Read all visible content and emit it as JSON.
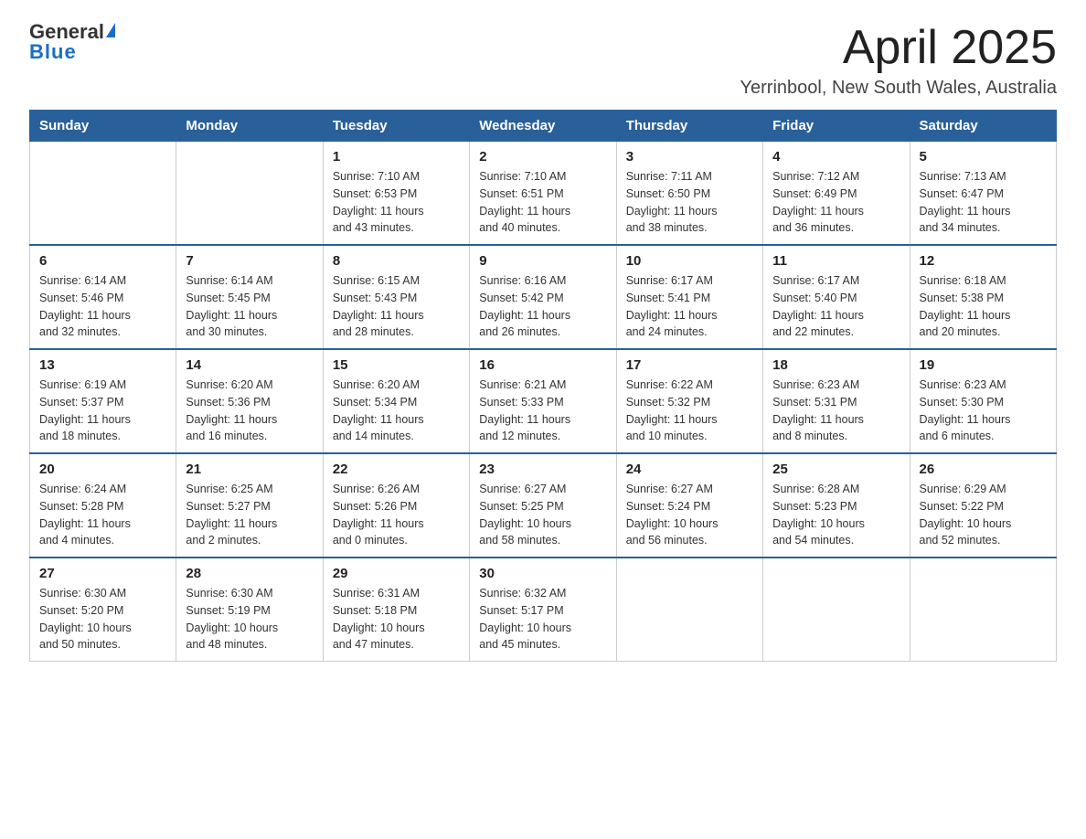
{
  "header": {
    "logo_general": "General",
    "logo_blue": "Blue",
    "month_title": "April 2025",
    "location": "Yerrinbool, New South Wales, Australia"
  },
  "columns": [
    "Sunday",
    "Monday",
    "Tuesday",
    "Wednesday",
    "Thursday",
    "Friday",
    "Saturday"
  ],
  "weeks": [
    [
      {
        "day": "",
        "info": ""
      },
      {
        "day": "",
        "info": ""
      },
      {
        "day": "1",
        "info": "Sunrise: 7:10 AM\nSunset: 6:53 PM\nDaylight: 11 hours\nand 43 minutes."
      },
      {
        "day": "2",
        "info": "Sunrise: 7:10 AM\nSunset: 6:51 PM\nDaylight: 11 hours\nand 40 minutes."
      },
      {
        "day": "3",
        "info": "Sunrise: 7:11 AM\nSunset: 6:50 PM\nDaylight: 11 hours\nand 38 minutes."
      },
      {
        "day": "4",
        "info": "Sunrise: 7:12 AM\nSunset: 6:49 PM\nDaylight: 11 hours\nand 36 minutes."
      },
      {
        "day": "5",
        "info": "Sunrise: 7:13 AM\nSunset: 6:47 PM\nDaylight: 11 hours\nand 34 minutes."
      }
    ],
    [
      {
        "day": "6",
        "info": "Sunrise: 6:14 AM\nSunset: 5:46 PM\nDaylight: 11 hours\nand 32 minutes."
      },
      {
        "day": "7",
        "info": "Sunrise: 6:14 AM\nSunset: 5:45 PM\nDaylight: 11 hours\nand 30 minutes."
      },
      {
        "day": "8",
        "info": "Sunrise: 6:15 AM\nSunset: 5:43 PM\nDaylight: 11 hours\nand 28 minutes."
      },
      {
        "day": "9",
        "info": "Sunrise: 6:16 AM\nSunset: 5:42 PM\nDaylight: 11 hours\nand 26 minutes."
      },
      {
        "day": "10",
        "info": "Sunrise: 6:17 AM\nSunset: 5:41 PM\nDaylight: 11 hours\nand 24 minutes."
      },
      {
        "day": "11",
        "info": "Sunrise: 6:17 AM\nSunset: 5:40 PM\nDaylight: 11 hours\nand 22 minutes."
      },
      {
        "day": "12",
        "info": "Sunrise: 6:18 AM\nSunset: 5:38 PM\nDaylight: 11 hours\nand 20 minutes."
      }
    ],
    [
      {
        "day": "13",
        "info": "Sunrise: 6:19 AM\nSunset: 5:37 PM\nDaylight: 11 hours\nand 18 minutes."
      },
      {
        "day": "14",
        "info": "Sunrise: 6:20 AM\nSunset: 5:36 PM\nDaylight: 11 hours\nand 16 minutes."
      },
      {
        "day": "15",
        "info": "Sunrise: 6:20 AM\nSunset: 5:34 PM\nDaylight: 11 hours\nand 14 minutes."
      },
      {
        "day": "16",
        "info": "Sunrise: 6:21 AM\nSunset: 5:33 PM\nDaylight: 11 hours\nand 12 minutes."
      },
      {
        "day": "17",
        "info": "Sunrise: 6:22 AM\nSunset: 5:32 PM\nDaylight: 11 hours\nand 10 minutes."
      },
      {
        "day": "18",
        "info": "Sunrise: 6:23 AM\nSunset: 5:31 PM\nDaylight: 11 hours\nand 8 minutes."
      },
      {
        "day": "19",
        "info": "Sunrise: 6:23 AM\nSunset: 5:30 PM\nDaylight: 11 hours\nand 6 minutes."
      }
    ],
    [
      {
        "day": "20",
        "info": "Sunrise: 6:24 AM\nSunset: 5:28 PM\nDaylight: 11 hours\nand 4 minutes."
      },
      {
        "day": "21",
        "info": "Sunrise: 6:25 AM\nSunset: 5:27 PM\nDaylight: 11 hours\nand 2 minutes."
      },
      {
        "day": "22",
        "info": "Sunrise: 6:26 AM\nSunset: 5:26 PM\nDaylight: 11 hours\nand 0 minutes."
      },
      {
        "day": "23",
        "info": "Sunrise: 6:27 AM\nSunset: 5:25 PM\nDaylight: 10 hours\nand 58 minutes."
      },
      {
        "day": "24",
        "info": "Sunrise: 6:27 AM\nSunset: 5:24 PM\nDaylight: 10 hours\nand 56 minutes."
      },
      {
        "day": "25",
        "info": "Sunrise: 6:28 AM\nSunset: 5:23 PM\nDaylight: 10 hours\nand 54 minutes."
      },
      {
        "day": "26",
        "info": "Sunrise: 6:29 AM\nSunset: 5:22 PM\nDaylight: 10 hours\nand 52 minutes."
      }
    ],
    [
      {
        "day": "27",
        "info": "Sunrise: 6:30 AM\nSunset: 5:20 PM\nDaylight: 10 hours\nand 50 minutes."
      },
      {
        "day": "28",
        "info": "Sunrise: 6:30 AM\nSunset: 5:19 PM\nDaylight: 10 hours\nand 48 minutes."
      },
      {
        "day": "29",
        "info": "Sunrise: 6:31 AM\nSunset: 5:18 PM\nDaylight: 10 hours\nand 47 minutes."
      },
      {
        "day": "30",
        "info": "Sunrise: 6:32 AM\nSunset: 5:17 PM\nDaylight: 10 hours\nand 45 minutes."
      },
      {
        "day": "",
        "info": ""
      },
      {
        "day": "",
        "info": ""
      },
      {
        "day": "",
        "info": ""
      }
    ]
  ]
}
